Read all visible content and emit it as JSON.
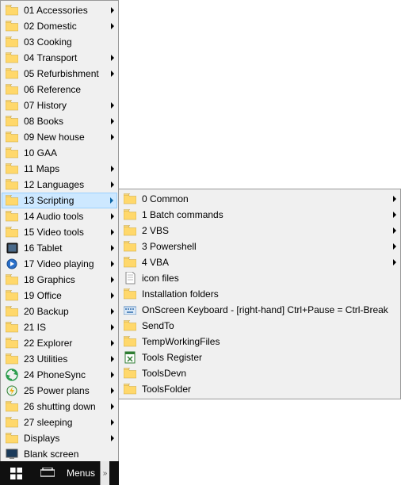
{
  "left_menu": [
    {
      "label": "01 Accessories",
      "icon": "folder",
      "arrow": true
    },
    {
      "label": "02 Domestic",
      "icon": "folder",
      "arrow": true
    },
    {
      "label": "03 Cooking",
      "icon": "folder",
      "arrow": false
    },
    {
      "label": "04 Transport",
      "icon": "folder",
      "arrow": true
    },
    {
      "label": "05 Refurbishment",
      "icon": "folder",
      "arrow": true
    },
    {
      "label": "06 Reference",
      "icon": "folder",
      "arrow": false
    },
    {
      "label": "07 History",
      "icon": "folder",
      "arrow": true
    },
    {
      "label": "08 Books",
      "icon": "folder",
      "arrow": true
    },
    {
      "label": "09 New house",
      "icon": "folder",
      "arrow": true
    },
    {
      "label": "10 GAA",
      "icon": "folder",
      "arrow": false
    },
    {
      "label": "11 Maps",
      "icon": "folder",
      "arrow": true
    },
    {
      "label": "12 Languages",
      "icon": "folder",
      "arrow": true
    },
    {
      "label": "13 Scripting",
      "icon": "folder",
      "arrow": true,
      "selected": true
    },
    {
      "label": "14 Audio tools",
      "icon": "folder",
      "arrow": true
    },
    {
      "label": "15 Video tools",
      "icon": "folder",
      "arrow": true
    },
    {
      "label": "16 Tablet",
      "icon": "tablet",
      "arrow": true
    },
    {
      "label": "17 Video playing",
      "icon": "video",
      "arrow": true
    },
    {
      "label": "18 Graphics",
      "icon": "folder",
      "arrow": true
    },
    {
      "label": "19 Office",
      "icon": "folder",
      "arrow": true
    },
    {
      "label": "20 Backup",
      "icon": "folder",
      "arrow": true
    },
    {
      "label": "21 IS",
      "icon": "folder",
      "arrow": true
    },
    {
      "label": "22 Explorer",
      "icon": "folder",
      "arrow": true
    },
    {
      "label": "23 Utilities",
      "icon": "folder",
      "arrow": true
    },
    {
      "label": "24 PhoneSync",
      "icon": "phonesync",
      "arrow": true
    },
    {
      "label": "25 Power plans",
      "icon": "power",
      "arrow": true
    },
    {
      "label": "26 shutting down",
      "icon": "folder",
      "arrow": true
    },
    {
      "label": "27 sleeping",
      "icon": "folder",
      "arrow": true
    },
    {
      "label": "Displays",
      "icon": "folder",
      "arrow": true
    },
    {
      "label": "Blank screen",
      "icon": "screen",
      "arrow": false
    }
  ],
  "right_menu": [
    {
      "label": "0 Common",
      "icon": "folder",
      "arrow": true
    },
    {
      "label": "1 Batch commands",
      "icon": "folder",
      "arrow": true
    },
    {
      "label": "2 VBS",
      "icon": "folder",
      "arrow": true
    },
    {
      "label": "3 Powershell",
      "icon": "folder",
      "arrow": true
    },
    {
      "label": "4 VBA",
      "icon": "folder",
      "arrow": true
    },
    {
      "label": "icon files",
      "icon": "file",
      "arrow": false
    },
    {
      "label": "Installation folders",
      "icon": "folder",
      "arrow": false
    },
    {
      "label": "OnScreen Keyboard - [right-hand] Ctrl+Pause = Ctrl-Break",
      "icon": "keyboard",
      "arrow": false
    },
    {
      "label": "SendTo",
      "icon": "folder",
      "arrow": false
    },
    {
      "label": "TempWorkingFiles",
      "icon": "folder",
      "arrow": false
    },
    {
      "label": "Tools Register",
      "icon": "xls",
      "arrow": false
    },
    {
      "label": "ToolsDevn",
      "icon": "folder",
      "arrow": false
    },
    {
      "label": "ToolsFolder",
      "icon": "folder",
      "arrow": false
    }
  ],
  "taskbar": {
    "menus_label": "Menus"
  }
}
